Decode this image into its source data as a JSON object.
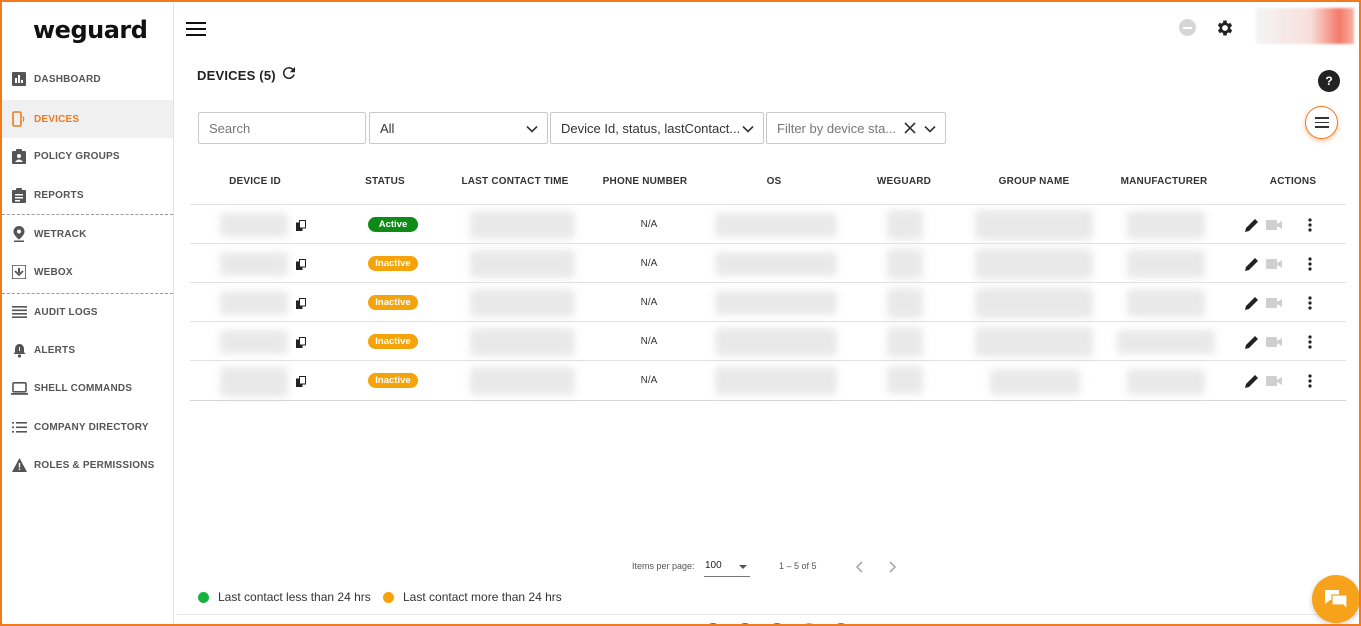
{
  "brand": {
    "logo_text": "weguard",
    "accent": "#f07a1c"
  },
  "sidebar": {
    "items": [
      {
        "label": "DASHBOARD",
        "icon": "bar-chart-icon",
        "active": false
      },
      {
        "label": "DEVICES",
        "icon": "phone-icon",
        "active": true
      },
      {
        "label": "POLICY GROUPS",
        "icon": "clipboard-person-icon",
        "active": false
      },
      {
        "label": "REPORTS",
        "icon": "clipboard-list-icon",
        "active": false
      },
      {
        "label": "WETRACK",
        "icon": "location-pin-icon",
        "active": false
      },
      {
        "label": "WEBOX",
        "icon": "box-icon",
        "active": false
      },
      {
        "label": "AUDIT LOGS",
        "icon": "list-icon",
        "active": false
      },
      {
        "label": "ALERTS",
        "icon": "bell-icon",
        "active": false
      },
      {
        "label": "SHELL COMMANDS",
        "icon": "laptop-icon",
        "active": false
      },
      {
        "label": "COMPANY DIRECTORY",
        "icon": "bulleted-list-icon",
        "active": false
      },
      {
        "label": "ROLES & PERMISSIONS",
        "icon": "warning-icon",
        "active": false
      }
    ]
  },
  "page": {
    "title": "DEVICES (5)",
    "help_label": "?"
  },
  "filters": {
    "search_placeholder": "Search",
    "type_value": "All",
    "columns_value": "Device Id, status, lastContact...",
    "state_placeholder": "Filter by device sta..."
  },
  "table": {
    "headers": [
      "DEVICE ID",
      "STATUS",
      "LAST CONTACT TIME",
      "PHONE NUMBER",
      "OS",
      "WEGUARD",
      "GROUP NAME",
      "MANUFACTURER",
      "ACTIONS"
    ],
    "rows": [
      {
        "status": "Active",
        "phone": "N/A"
      },
      {
        "status": "Inactive",
        "phone": "N/A"
      },
      {
        "status": "Inactive",
        "phone": "N/A"
      },
      {
        "status": "Inactive",
        "phone": "N/A"
      },
      {
        "status": "Inactive",
        "phone": "N/A"
      }
    ]
  },
  "pagination": {
    "items_label": "Items per page:",
    "page_size": "100",
    "range": "1 – 5 of 5"
  },
  "legend": [
    {
      "label": "Last contact less than 24 hrs",
      "color": "#16b342"
    },
    {
      "label": "Last contact more than 24 hrs",
      "color": "#f5a30a"
    }
  ],
  "colors": {
    "active": "#0e8a17",
    "inactive": "#f5a30a",
    "chat": "#f7a21b"
  }
}
